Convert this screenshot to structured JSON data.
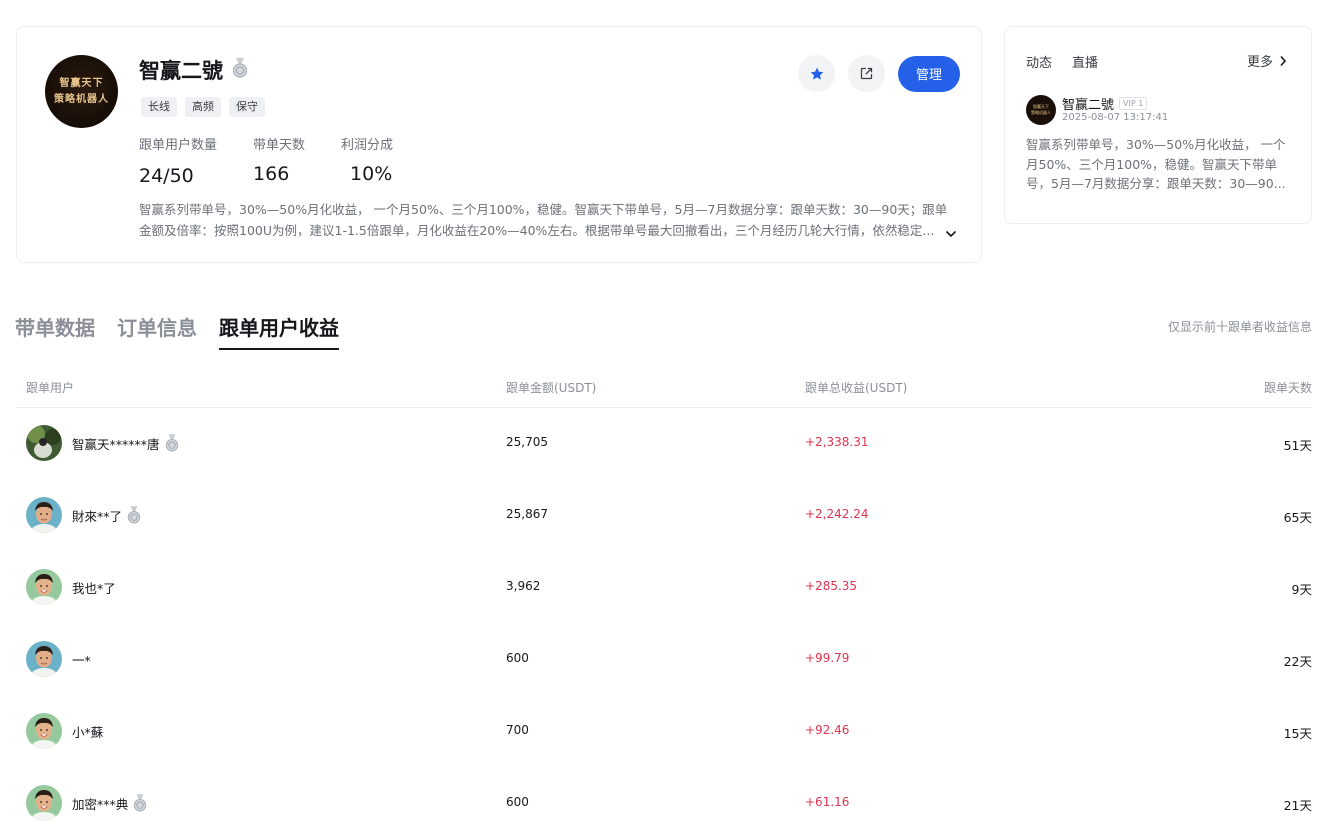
{
  "profile": {
    "avatar_line1": "智赢天下",
    "avatar_line2": "策略机器人",
    "name": "智赢二號",
    "tags": [
      "长线",
      "高频",
      "保守"
    ],
    "stats": [
      {
        "label": "跟单用户数量",
        "value": "24/50"
      },
      {
        "label": "带单天数",
        "value": "166"
      },
      {
        "label": "利润分成",
        "value": "10%"
      }
    ],
    "description_line1": "智赢系列带单号，30%—50%月化收益， 一个月50%、三个月100%，稳健。智赢天下带单号，5月—7月数据分享：跟单天数：30—90天；跟单",
    "description_line2": "金额及倍率：按照100U为例，建议1-1.5倍跟单，月化收益在20%—40%左右。根据带单号最大回撤看出，三个月经历几轮大行情，依然稳定...",
    "manage_label": "管理",
    "accent_color": "#2460e8"
  },
  "feed": {
    "tabs": [
      "动态",
      "直播"
    ],
    "more_label": "更多",
    "post": {
      "author": "智赢二號",
      "badge": "VIP 1",
      "time": "2025-08-07 13:17:41",
      "text": "智赢系列带单号，30%—50%月化收益， 一个月50%、三个月100%，稳健。智赢天下带单号，5月—7月数据分享：跟单天数：30—90..."
    }
  },
  "tabs": {
    "items": [
      "带单数据",
      "订单信息",
      "跟单用户收益"
    ],
    "active_index": 2,
    "note": "仅显示前十跟单者收益信息"
  },
  "table": {
    "headers": [
      "跟单用户",
      "跟单金额(USDT)",
      "跟单总收益(USDT)",
      "跟单天数"
    ],
    "profit_color": "#e0334f",
    "rows": [
      {
        "user": "智赢天******唐",
        "medal": true,
        "amount": "25,705",
        "profit": "+2,338.31",
        "days": "51天"
      },
      {
        "user": "財來**了",
        "medal": true,
        "amount": "25,867",
        "profit": "+2,242.24",
        "days": "65天"
      },
      {
        "user": "我也*了",
        "medal": false,
        "amount": "3,962",
        "profit": "+285.35",
        "days": "9天"
      },
      {
        "user": "一*",
        "medal": false,
        "amount": "600",
        "profit": "+99.79",
        "days": "22天"
      },
      {
        "user": "小*蘇",
        "medal": false,
        "amount": "700",
        "profit": "+92.46",
        "days": "15天"
      },
      {
        "user": "加密***典",
        "medal": true,
        "amount": "600",
        "profit": "+61.16",
        "days": "21天"
      }
    ]
  }
}
